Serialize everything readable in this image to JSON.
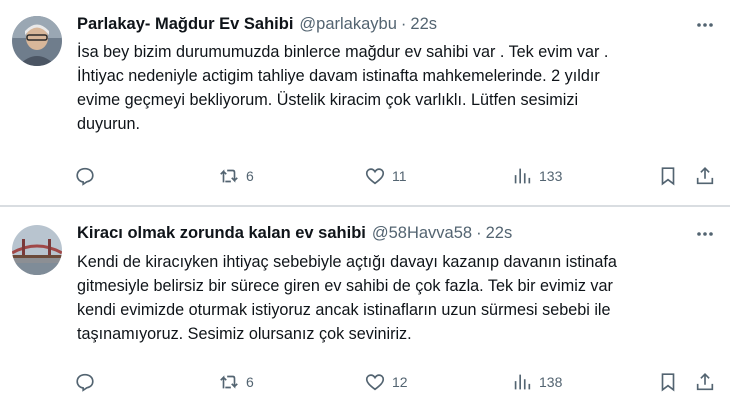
{
  "tweets": [
    {
      "name": "Parlakay- Mağdur Ev Sahibi",
      "handle": "@parlakaybu",
      "sep": "·",
      "time": "22s",
      "text": "İsa bey  bizim durumumuzda binlerce mağdur ev sahibi var . Tek evim var .\nİhtiyac nedeniyle actigim tahliye davam istinafta  mahkemelerinde. 2 yıldır\nevime geçmeyi bekliyorum. Üstelik kiracim çok varlıklı.  Lütfen sesimizi\nduyurun.",
      "retweets": "6",
      "likes": "11",
      "views": "133",
      "avatar_icon": "avatar-photo-man"
    },
    {
      "name": "Kiracı olmak zorunda kalan ev sahibi",
      "handle": "@58Havva58",
      "sep": "·",
      "time": "22s",
      "text": "Kendi de kiracıyken ihtiyaç sebebiyle açtığı davayı kazanıp davanın istinafa\ngitmesiyle belirsiz bir sürece giren ev sahibi de çok fazla. Tek bir evimiz var\nkendi evimizde oturmak istiyoruz ancak istinafların uzun sürmesi sebebi ile\ntaşınamıyoruz. Sesimiz olursanız çok seviniriz.",
      "retweets": "6",
      "likes": "12",
      "views": "138",
      "avatar_icon": "avatar-photo-bridge"
    }
  ],
  "icons": {
    "reply": "reply-icon",
    "retweet": "retweet-icon",
    "like": "heart-icon",
    "views": "views-icon",
    "bookmark": "bookmark-icon",
    "share": "share-icon",
    "more": "more-icon"
  },
  "colors": {
    "text": "#0f1419",
    "muted": "#536471",
    "divider": "#d9dde1"
  }
}
